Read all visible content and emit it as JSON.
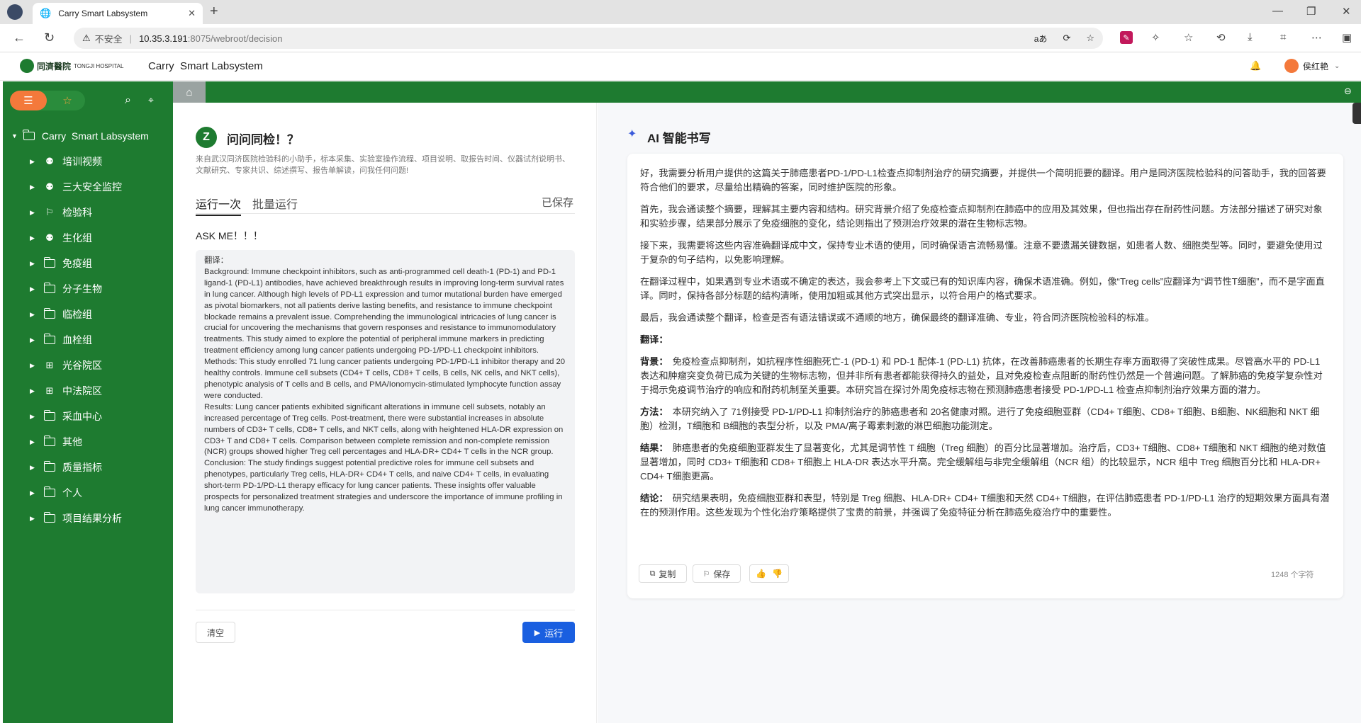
{
  "browser": {
    "tab_title": "Carry Smart Labsystem",
    "insecure_label": "不安全",
    "url_host": "10.35.3.191",
    "url_rest": ":8075/webroot/decision"
  },
  "app": {
    "logo_text_cn": "同濟醫院",
    "logo_text_en": "TONGJI HOSPITAL",
    "title": "Carry  Smart Labsystem",
    "user_name": "侯红艳"
  },
  "sidebar": {
    "root_label": "Carry  Smart Labsystem",
    "items": [
      {
        "label": "培训视频",
        "icon": "user-group-icon"
      },
      {
        "label": "三大安全监控",
        "icon": "user-group-icon"
      },
      {
        "label": "检验科",
        "icon": "bell-icon"
      },
      {
        "label": "生化组",
        "icon": "user-group-icon"
      },
      {
        "label": "免疫组",
        "icon": "folder-icon"
      },
      {
        "label": "分子生物",
        "icon": "folder-icon"
      },
      {
        "label": "临检组",
        "icon": "folder-icon"
      },
      {
        "label": "血栓组",
        "icon": "folder-icon"
      },
      {
        "label": "光谷院区",
        "icon": "grid-icon"
      },
      {
        "label": "中法院区",
        "icon": "grid-icon"
      },
      {
        "label": "采血中心",
        "icon": "folder-icon"
      },
      {
        "label": "其他",
        "icon": "folder-icon"
      },
      {
        "label": "质量指标",
        "icon": "folder-icon"
      },
      {
        "label": "个人",
        "icon": "folder-icon"
      },
      {
        "label": "项目结果分析",
        "icon": "folder-icon"
      }
    ]
  },
  "left": {
    "title": "问问同检！？",
    "description": "来自武汉同济医院检验科的小助手，标本采集、实验室操作流程、项目说明、取报告时间、仪器试剂说明书、文献研究、专家共识、综述撰写、报告单解读，问我任何问题!",
    "tab_run_once": "运行一次",
    "tab_batch": "批量运行",
    "saved_label": "已保存",
    "prompt_label": "ASK ME！！！",
    "input_text": "翻译：\nBackground: Immune checkpoint inhibitors, such as anti-programmed cell death-1 (PD-1) and PD-1 ligand-1 (PD-L1) antibodies, have achieved breakthrough results in improving long-term survival rates in lung cancer. Although high levels of PD-L1 expression and tumor mutational burden have emerged as pivotal biomarkers, not all patients derive lasting benefits, and resistance to immune checkpoint blockade remains a prevalent issue. Comprehending the immunological intricacies of lung cancer is crucial for uncovering the mechanisms that govern responses and resistance to immunomodulatory treatments. This study aimed to explore the potential of peripheral immune markers in predicting treatment efficiency among lung cancer patients undergoing PD-1/PD-L1 checkpoint inhibitors.\nMethods: This study enrolled 71 lung cancer patients undergoing PD-1/PD-L1 inhibitor therapy and 20 healthy controls. Immune cell subsets (CD4+ T cells, CD8+ T cells, B cells, NK cells, and NKT cells), phenotypic analysis of T cells and B cells, and PMA/Ionomycin-stimulated lymphocyte function assay were conducted.\nResults: Lung cancer patients exhibited significant alterations in immune cell subsets, notably an increased percentage of Treg cells. Post-treatment, there were substantial increases in absolute numbers of CD3+ T cells, CD8+ T cells, and NKT cells, along with heightened HLA-DR expression on CD3+ T and CD8+ T cells. Comparison between complete remission and non-complete remission (NCR) groups showed higher Treg cell percentages and HLA-DR+ CD4+ T cells in the NCR group.\nConclusion: The study findings suggest potential predictive roles for immune cell subsets and phenotypes, particularly Treg cells, HLA-DR+ CD4+ T cells, and naive CD4+ T cells, in evaluating short-term PD-1/PD-L1 therapy efficacy for lung cancer patients. These insights offer valuable prospects for personalized treatment strategies and underscore the importance of immune profiling in lung cancer immunotherapy.",
    "clear_label": "清空",
    "run_label": "运行"
  },
  "right": {
    "title": "AI 智能书写",
    "paragraphs": [
      {
        "head": "",
        "text": "好，我需要分析用户提供的这篇关于肺癌患者PD-1/PD-L1检查点抑制剂治疗的研究摘要，并提供一个简明扼要的翻译。用户是同济医院检验科的问答助手，我的回答要符合他们的要求，尽量给出精确的答案，同时维护医院的形象。"
      },
      {
        "head": "",
        "text": "首先，我会通读整个摘要，理解其主要内容和结构。研究背景介绍了免疫检查点抑制剂在肺癌中的应用及其效果，但也指出存在耐药性问题。方法部分描述了研究对象和实验步骤，结果部分展示了免疫细胞的变化，结论则指出了预测治疗效果的潜在生物标志物。"
      },
      {
        "head": "",
        "text": "接下来，我需要将这些内容准确翻译成中文，保持专业术语的使用，同时确保语言流畅易懂。注意不要遗漏关键数据，如患者人数、细胞类型等。同时，要避免使用过于复杂的句子结构，以免影响理解。"
      },
      {
        "head": "",
        "text": "在翻译过程中，如果遇到专业术语或不确定的表达，我会参考上下文或已有的知识库内容，确保术语准确。例如，像“Treg cells”应翻译为“调节性T细胞”，而不是字面直译。同时，保持各部分标题的结构清晰，使用加粗或其他方式突出显示，以符合用户的格式要求。"
      },
      {
        "head": "",
        "text": "最后，我会通读整个翻译，检查是否有语法错误或不通顺的地方，确保最终的翻译准确、专业，符合同济医院检验科的标准。"
      },
      {
        "head": "翻译：",
        "text": ""
      },
      {
        "head": "背景：",
        "text": "免疫检查点抑制剂，如抗程序性细胞死亡-1 (PD-1) 和 PD-1 配体-1 (PD-L1) 抗体，在改善肺癌患者的长期生存率方面取得了突破性成果。尽管高水平的 PD-L1 表达和肿瘤突变负荷已成为关键的生物标志物，但并非所有患者都能获得持久的益处，且对免疫检查点阻断的耐药性仍然是一个普遍问题。了解肺癌的免疫学复杂性对于揭示免疫调节治疗的响应和耐药机制至关重要。本研究旨在探讨外周免疫标志物在预测肺癌患者接受 PD-1/PD-L1 检查点抑制剂治疗效果方面的潜力。"
      },
      {
        "head": "方法：",
        "text": "本研究纳入了 71例接受 PD-1/PD-L1 抑制剂治疗的肺癌患者和 20名健康对照。进行了免疫细胞亚群（CD4+ T细胞、CD8+ T细胞、B细胞、NK细胞和 NKT 细胞）检测，T细胞和 B细胞的表型分析，以及 PMA/离子霉素刺激的淋巴细胞功能测定。"
      },
      {
        "head": "结果：",
        "text": "肺癌患者的免疫细胞亚群发生了显著变化，尤其是调节性 T 细胞（Treg 细胞）的百分比显著增加。治疗后，CD3+ T细胞、CD8+ T细胞和 NKT 细胞的绝对数值显著增加，同时 CD3+ T细胞和 CD8+ T细胞上 HLA-DR 表达水平升高。完全缓解组与非完全缓解组（NCR 组）的比较显示，NCR 组中 Treg 细胞百分比和 HLA-DR+ CD4+ T细胞更高。"
      },
      {
        "head": "结论：",
        "text": "研究结果表明，免疫细胞亚群和表型，特别是 Treg 细胞、HLA-DR+ CD4+ T细胞和天然 CD4+ T细胞，在评估肺癌患者 PD-1/PD-L1 治疗的短期效果方面具有潜在的预测作用。这些发现为个性化治疗策略提供了宝贵的前景，并强调了免疫特征分析在肺癌免疫治疗中的重要性。"
      }
    ],
    "copy_label": "复制",
    "save_label": "保存",
    "char_count": "1248 个字符"
  }
}
